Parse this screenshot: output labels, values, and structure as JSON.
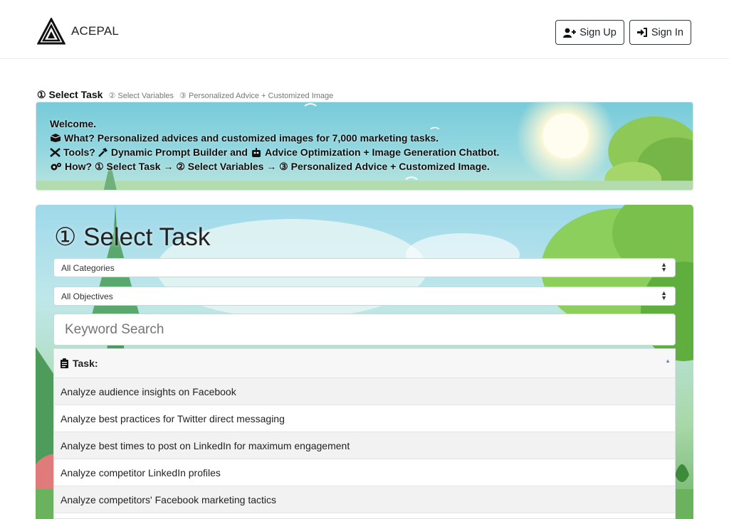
{
  "brand": {
    "name": "ACEPAL"
  },
  "auth": {
    "signup_label": "Sign Up",
    "signin_label": "Sign In"
  },
  "steps": {
    "step1": "① Select Task",
    "step2": "② Select Variables",
    "step3": "③ Personalized Advice + Customized Image"
  },
  "welcome": {
    "line1": "Welcome.",
    "what_label": "What?",
    "what_text": "Personalized advices and customized images for 7,000 marketing tasks.",
    "tools_label": "Tools?",
    "tools_text_a": "Dynamic Prompt Builder and",
    "tools_text_b": "Advice Optimization + Image Generation Chatbot.",
    "how_label": "How?",
    "how_text": "① Select Task → ② Select Variables → ③ Personalized Advice + Customized Image."
  },
  "panel": {
    "title": "① Select Task",
    "category_select": "All Categories",
    "objective_select": "All Objectives",
    "search_placeholder": "Keyword Search"
  },
  "task_list": {
    "header": "Task:",
    "rows": [
      "Analyze audience insights on Facebook",
      "Analyze best practices for Twitter direct messaging",
      "Analyze best times to post on LinkedIn for maximum engagement",
      "Analyze competitor LinkedIn profiles",
      "Analyze competitors' Facebook marketing tactics"
    ]
  },
  "icons": {
    "logo": "triangle-logo",
    "signup": "user-plus-icon",
    "signin": "sign-in-icon",
    "what": "box-icon",
    "tools": "tools-icon",
    "hammer": "hammer-icon",
    "robot": "robot-icon",
    "how": "gears-icon",
    "clipboard": "clipboard-icon",
    "sort": "sort-up-icon"
  },
  "colors": {
    "button_border": "#343a40",
    "sort_caret": "#6d83c9"
  }
}
